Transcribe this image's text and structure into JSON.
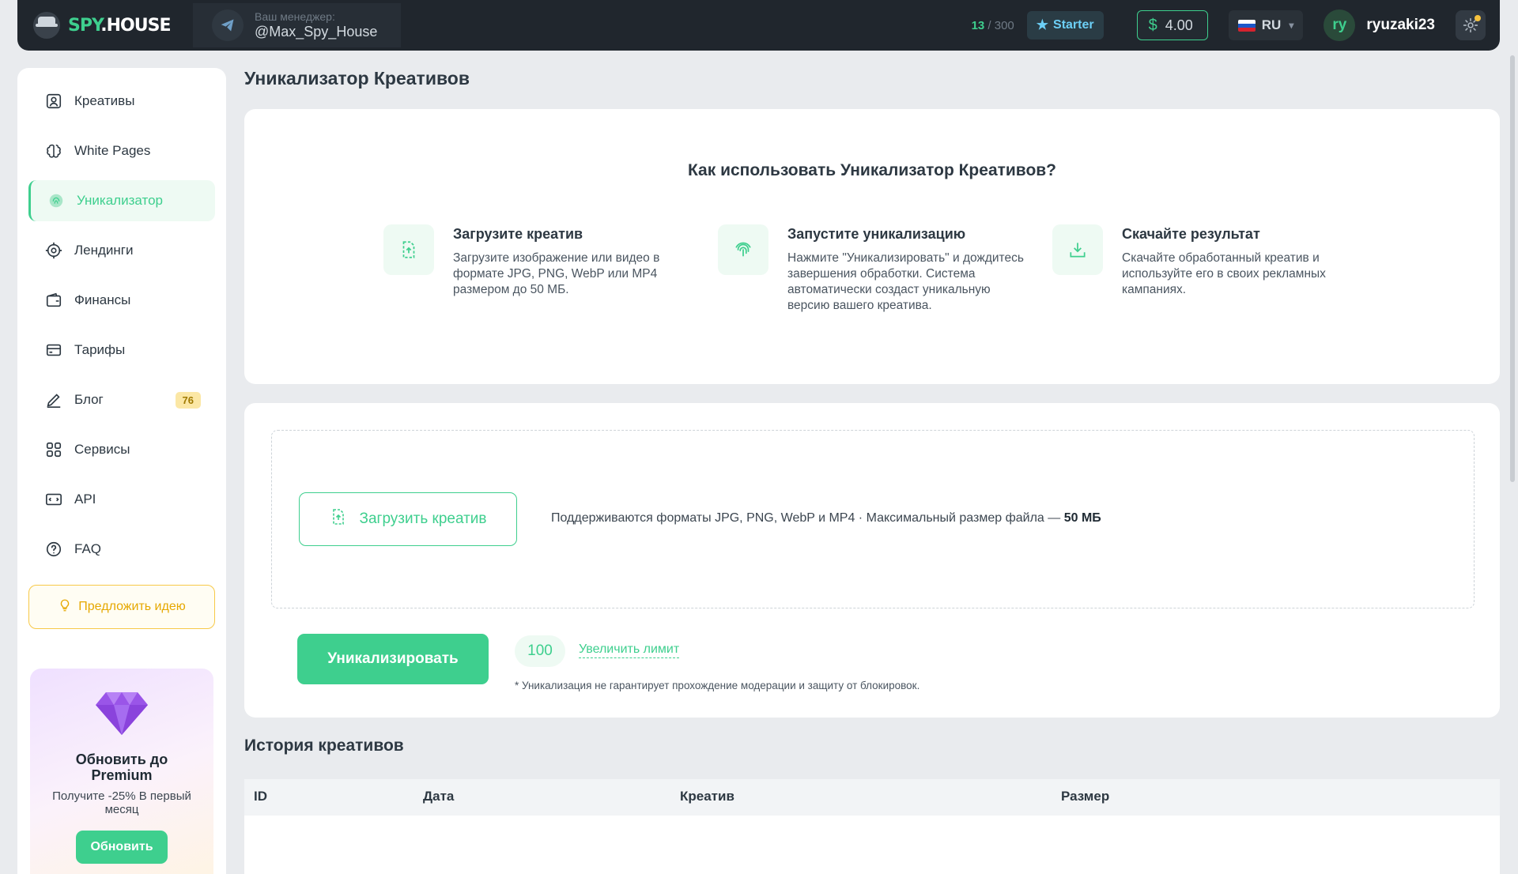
{
  "brand": {
    "spy": "SPY",
    "house": ".HOUSE"
  },
  "manager": {
    "label": "Ваш менеджер:",
    "name": "@Max_Spy_House"
  },
  "topbar": {
    "counter_used": "13",
    "counter_total": " / 300",
    "plan": "Starter",
    "balance_symbol": "$",
    "balance": "4.00",
    "language": "RU",
    "avatar_initials": "ry",
    "username": "ryuzaki23"
  },
  "sidebar": {
    "items": [
      {
        "label": "Креативы",
        "icon": "creatives-icon"
      },
      {
        "label": "White Pages",
        "icon": "brain-icon"
      },
      {
        "label": "Уникализатор",
        "icon": "fingerprint-icon",
        "active": true
      },
      {
        "label": "Лендинги",
        "icon": "target-icon"
      },
      {
        "label": "Финансы",
        "icon": "wallet-icon"
      },
      {
        "label": "Тарифы",
        "icon": "card-icon"
      },
      {
        "label": "Блог",
        "icon": "pen-icon",
        "badge": "76"
      },
      {
        "label": "Сервисы",
        "icon": "grid-icon"
      },
      {
        "label": "API",
        "icon": "api-icon"
      },
      {
        "label": "FAQ",
        "icon": "question-icon"
      }
    ],
    "idea_button": "Предложить идею",
    "promo": {
      "title": "Обновить до Premium",
      "subtitle": "Получите -25% В первый месяц",
      "button": "Обновить"
    }
  },
  "page": {
    "title": "Уникализатор Креативов"
  },
  "howto": {
    "title": "Как использовать Уникализатор Креативов?",
    "steps": [
      {
        "title": "Загрузите креатив",
        "text": "Загрузите изображение или видео в формате JPG, PNG, WebP или MP4 размером до 50 МБ."
      },
      {
        "title": "Запустите уникализацию",
        "text": "Нажмите \"Уникализировать\" и дождитесь завершения обработки. Система автоматически создаст уникальную версию вашего креатива."
      },
      {
        "title": "Скачайте результат",
        "text": "Скачайте обработанный креатив и используйте его в своих рекламных кампаниях."
      }
    ]
  },
  "upload": {
    "button": "Загрузить креатив",
    "formats_text": "Поддерживаются форматы JPG, PNG, WebP и MP4 · Максимальный размер файла —",
    "max_size": "50 МБ",
    "uniq_button": "Уникализировать",
    "limit": "100",
    "limit_link": "Увеличить лимит",
    "disclaimer": "* Уникализация не гарантирует прохождение модерации и защиту от блокировок."
  },
  "history": {
    "title": "История креативов",
    "columns": [
      "ID",
      "Дата",
      "Креатив",
      "Размер"
    ]
  },
  "colors": {
    "accent": "#3ecf8e",
    "topbar": "#20262d",
    "warning": "#f7c948"
  }
}
